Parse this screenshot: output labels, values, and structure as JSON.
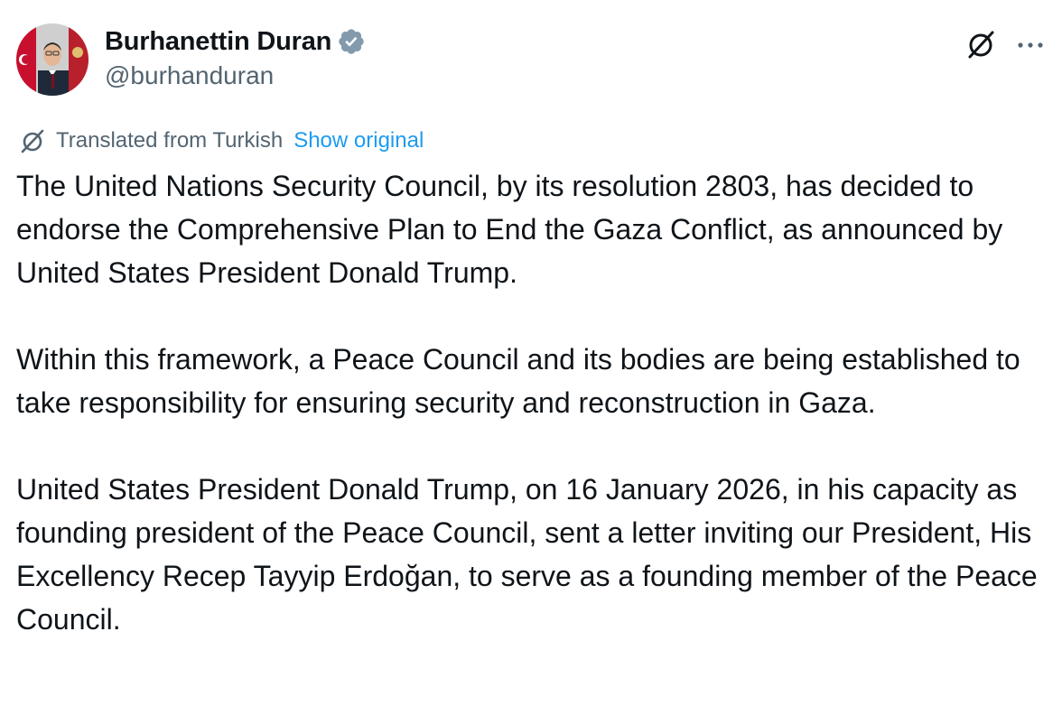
{
  "author": {
    "display_name": "Burhanettin Duran",
    "handle": "@burhanduran",
    "verified": true,
    "avatar_icon": "profile-photo"
  },
  "header_actions": {
    "grok_icon": "grok-slash-circle-icon",
    "more_icon": "ellipsis-horizontal-icon"
  },
  "translation": {
    "icon": "translate-slash-circle-icon",
    "label": "Translated from Turkish",
    "show_original": "Show original"
  },
  "post": {
    "paragraphs": [
      "The United Nations Security Council, by its resolution 2803, has decided to endorse the Comprehensive Plan to End the Gaza Conflict, as announced by United States President Donald Trump.",
      "Within this framework, a Peace Council and its bodies are being established to take responsibility for ensuring security and reconstruction in Gaza.",
      "United States President Donald Trump, on 16 January 2026, in his capacity as founding president of the Peace Council, sent a letter inviting our President, His Excellency Recep Tayyip Erdoğan, to serve as a founding member of the Peace Council."
    ]
  },
  "colors": {
    "text_primary": "#0f1419",
    "text_secondary": "#536471",
    "link": "#1d9bf0",
    "verified_badge": "#829aab"
  }
}
